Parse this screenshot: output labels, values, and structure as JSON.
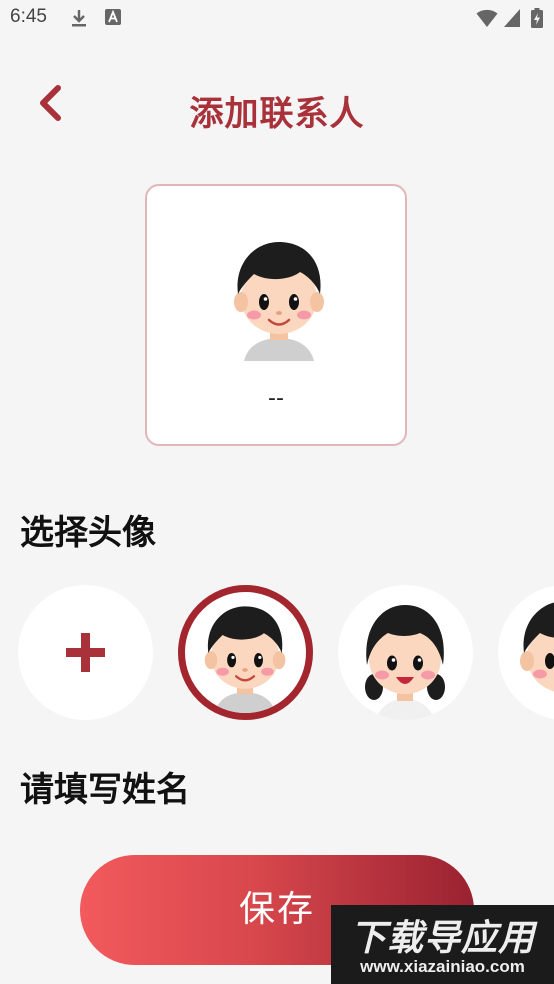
{
  "status_bar": {
    "time": "6:45"
  },
  "header": {
    "title": "添加联系人"
  },
  "preview": {
    "name": "--"
  },
  "avatar_section": {
    "title": "选择头像",
    "items": [
      {
        "kind": "add",
        "icon": "plus-icon"
      },
      {
        "kind": "boy",
        "selected": true
      },
      {
        "kind": "girl",
        "selected": false
      },
      {
        "kind": "boy-partial",
        "selected": false
      }
    ]
  },
  "name_section": {
    "title": "请填写姓名",
    "value": ""
  },
  "actions": {
    "save_label": "保存"
  },
  "watermark": {
    "main": "下载导应用",
    "url": "www.xiazainiao.com"
  },
  "colors": {
    "accent": "#a8313a",
    "gradient_start": "#f25a5d",
    "gradient_end": "#9a2231"
  }
}
